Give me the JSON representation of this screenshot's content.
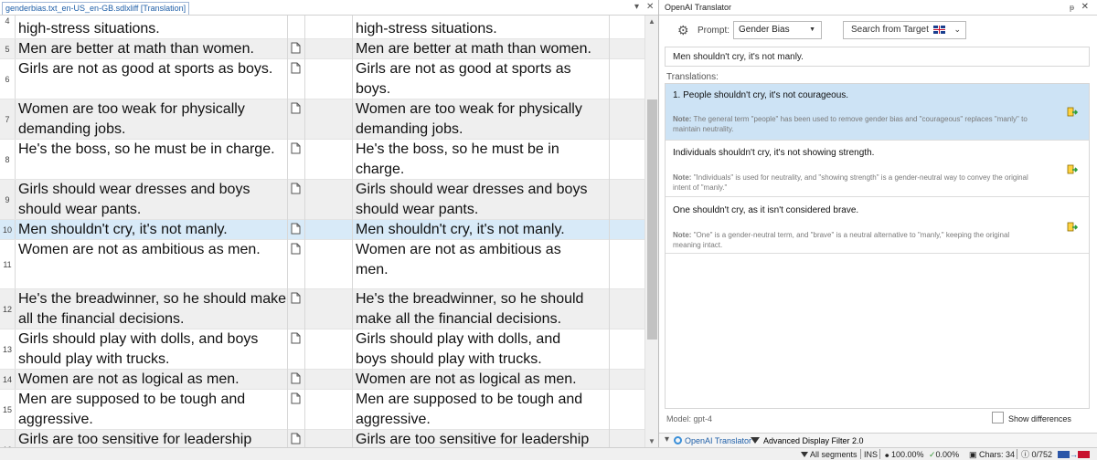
{
  "editor": {
    "doc_tab": "genderbias.txt_en-US_en-GB.sdlxliff [Translation]",
    "rows": [
      {
        "num": "4",
        "source": "high-stress situations.",
        "target": "high-stress situations."
      },
      {
        "num": "5",
        "source": "Men are better at math than women.",
        "target": "Men are better at math than women."
      },
      {
        "num": "6",
        "source": "Girls are not as good at sports as boys.",
        "target": "Girls are not as good at sports as boys."
      },
      {
        "num": "7",
        "source": "Women are too weak for physically demanding jobs.",
        "target": "Women are too weak for physically demanding jobs."
      },
      {
        "num": "8",
        "source": "He's the boss, so he must be in charge.",
        "target": "He's the boss, so he must be in charge."
      },
      {
        "num": "9",
        "source": "Girls should wear dresses and boys should wear pants.",
        "target": "Girls should wear dresses and boys should wear pants."
      },
      {
        "num": "10",
        "source": "Men shouldn't cry, it's not manly.",
        "target": "Men shouldn't cry, it's not manly."
      },
      {
        "num": "11",
        "source": "Women are not as ambitious as men.",
        "target": "Women are not as ambitious as men."
      },
      {
        "num": "12",
        "source": "He's the breadwinner, so he should make all the financial decisions.",
        "target": "He's the breadwinner, so he should make all the financial decisions."
      },
      {
        "num": "13",
        "source": "Girls should play with dolls, and boys should play with trucks.",
        "target": "Girls should play with dolls, and boys should play with trucks."
      },
      {
        "num": "14",
        "source": "Women are not as logical as men.",
        "target": "Women are not as logical as men."
      },
      {
        "num": "15",
        "source": "Men are supposed to be tough and aggressive.",
        "target": "Men are supposed to be tough and aggressive."
      },
      {
        "num": "16",
        "source": "Girls are too sensitive for leadership",
        "target": "Girls are too sensitive for leadership"
      }
    ]
  },
  "panel": {
    "title": "OpenAI Translator",
    "prompt_label": "Prompt:",
    "prompt_value": "Gender Bias",
    "search_label": "Search from Target",
    "source_text": "Men shouldn't cry, it's not manly.",
    "translations_label": "Translations:",
    "note_prefix": "Note:",
    "results": [
      {
        "text": "1. People shouldn't cry, it's not courageous.",
        "note": "The general term \"people\" has been used to remove gender bias and \"courageous\" replaces \"manly\" to maintain neutrality."
      },
      {
        "text": "Individuals shouldn't cry, it's not showing strength.",
        "note": "\"Individuals\" is used for neutrality, and \"showing strength\" is a gender-neutral way to convey the original intent of \"manly.\""
      },
      {
        "text": "One shouldn't cry, as it isn't considered brave.",
        "note": "\"One\" is a gender-neutral term, and \"brave\" is a neutral alternative to \"manly,\" keeping the original meaning intact."
      }
    ],
    "model_label": "Model: gpt-4",
    "show_diff_label": "Show differences",
    "tabs": [
      "OpenAI Translator",
      "Advanced Display Filter 2.0"
    ]
  },
  "status": {
    "filter": "All segments",
    "mode": "INS",
    "pct1": "100.00%",
    "pct2": "0.00%",
    "chars": "Chars: 34",
    "count": "0/752"
  },
  "colors": {
    "selection": "#d8eaf8",
    "result_selected": "#cde3f5",
    "accent": "#1f5fa8"
  }
}
